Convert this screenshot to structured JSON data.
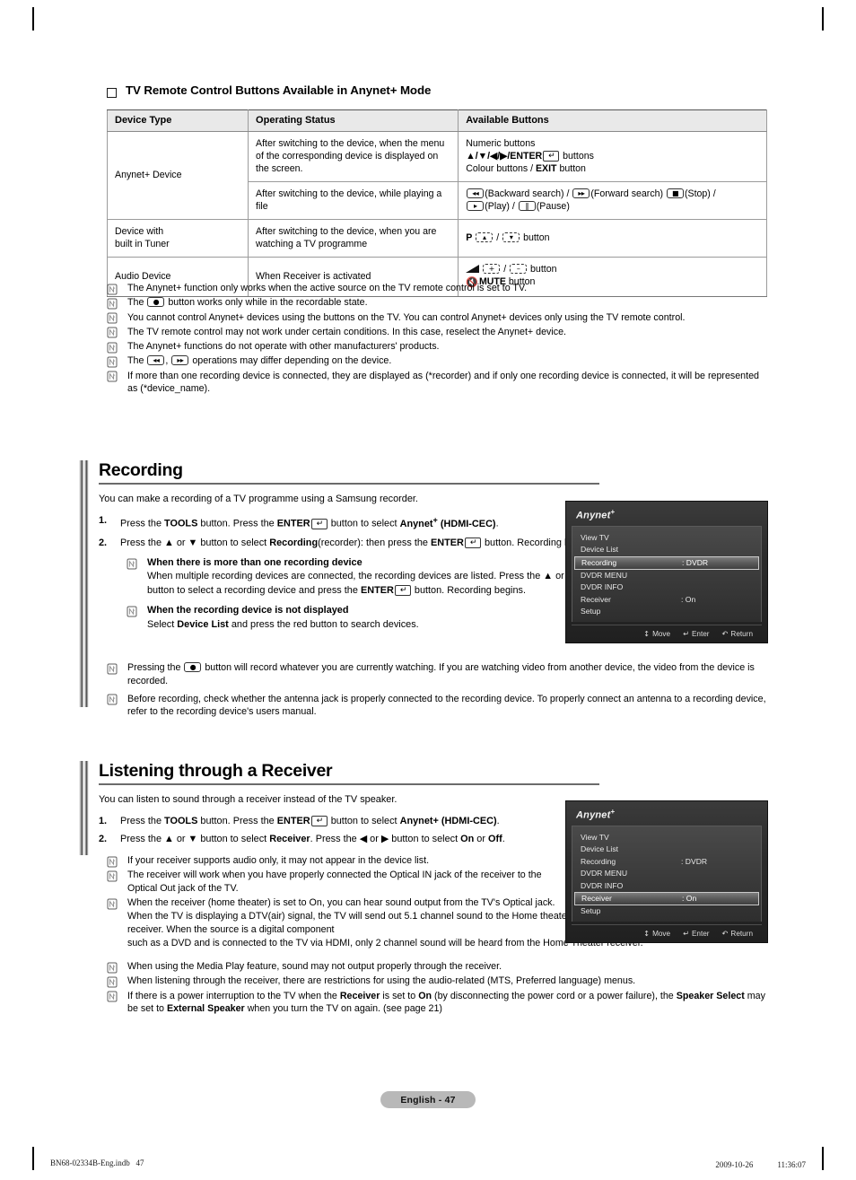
{
  "page": {
    "number_label": "English - 47",
    "footer_left": "BN68-02334B-Eng.indb   47",
    "footer_right": "2009-10-26   　　 11:36:07"
  },
  "remote_section": {
    "heading": "TV Remote Control Buttons Available in Anynet+ Mode",
    "table": {
      "headers": [
        "Device Type",
        "Operating Status",
        "Available Buttons"
      ],
      "rows": [
        {
          "device": "Anynet+ Device",
          "status": "After switching to the device, when the menu of the corresponding device is displayed on the screen.",
          "buttons_lines": [
            "Numeric buttons",
            "▲/▼/◀/▶/ENTER buttons",
            "Colour buttons / EXIT button"
          ]
        },
        {
          "device": "",
          "status": "After switching to the device, while playing a file",
          "buttons_lines": [
            "(Backward search) / (Forward search) (Stop) /",
            "(Play) / (Pause)"
          ]
        },
        {
          "device": "Device with built in Tuner",
          "device_line1": "Device with",
          "device_line2": "built in Tuner",
          "status": "After switching to the device, when you are watching a TV programme",
          "buttons_lines": [
            "P  /  button"
          ]
        },
        {
          "device": "Audio Device",
          "status": "When Receiver is activated",
          "buttons_lines": [
            " / button",
            "MUTE button"
          ]
        }
      ]
    },
    "notes": [
      "The Anynet+ function only works when the active source on the TV remote control is set to TV.",
      "The  button works only while in the recordable state.",
      "You cannot control Anynet+ devices using the buttons on the TV. You can control Anynet+ devices only using the TV remote control.",
      "The TV remote control may not work under certain conditions. In this case, reselect the Anynet+ device.",
      "The Anynet+ functions do not operate with other manufacturers' products.",
      "The  ,  operations may differ depending on the device.",
      "If more than one recording device is connected, they are displayed as (*recorder) and if only one recording device is connected, it will be represented as (*device_name)."
    ]
  },
  "recording": {
    "heading": "Recording",
    "lead": "You can make a recording of a TV programme using a Samsung recorder.",
    "steps": [
      {
        "n": "1.",
        "text": "Press the TOOLS button. Press the ENTER button to select Anynet+ (HDMI-CEC)."
      },
      {
        "n": "2.",
        "text": "Press the ▲ or ▼ button to select Recording(recorder): then press the ENTER button. Recording begins."
      }
    ],
    "subnotes": [
      {
        "title": "When there is more than one recording device",
        "body": "When multiple recording devices are connected, the recording devices are listed. Press the ▲ or ▼ button to select a recording device and press the ENTER button. Recording begins."
      },
      {
        "title": "When the recording device is not displayed",
        "body": "Select Device List and press the red button to search devices."
      }
    ],
    "notes": [
      "Pressing the  button will record whatever you are currently watching. If you are watching video from another device, the video from the device is recorded.",
      "Before recording, check whether the antenna jack is properly connected to the recording device. To properly connect an antenna to a recording device, refer to the recording device's users manual."
    ]
  },
  "receiver": {
    "heading": "Listening through a Receiver",
    "lead": "You can listen to sound through a receiver instead of the TV speaker.",
    "steps": [
      {
        "n": "1.",
        "text": "Press the TOOLS button. Press the ENTER button to select Anynet+ (HDMI-CEC)."
      },
      {
        "n": "2.",
        "text": "Press the ▲ or ▼ button to select Receiver. Press the ◀ or ▶ button to select On or Off."
      }
    ],
    "notes": [
      "If your receiver supports audio only, it may not appear in the device list.",
      "The receiver will work when you have properly connected the Optical IN jack of the receiver to the Optical Out jack of the TV.",
      "When the receiver (home theater) is set to On, you can hear sound output from the TV's Optical jack. When the TV is displaying a DTV(air) signal, the TV will send out 5.1 channel sound to the Home theater receiver. When the source is a digital component such as a DVD and is connected to the TV via HDMI, only 2 channel sound will be heard from the Home Theater receiver.",
      "When using the Media Play feature, sound may not output properly through the receiver.",
      "When listening through the receiver, there are restrictions for using the audio-related (MTS, Preferred language) menus.",
      "If there is a power interruption to the TV when the Receiver is set to On (by disconnecting the power cord or a power failure), the Speaker Select may be set to External Speaker when you turn the TV on again. (see page 21)"
    ]
  },
  "osd": {
    "brand": "Anynet",
    "brand_sup": "+",
    "items": [
      {
        "label": "View TV",
        "value": ""
      },
      {
        "label": "Device List",
        "value": ""
      },
      {
        "label": "Recording",
        "value": ": DVDR"
      },
      {
        "label": "DVDR MENU",
        "value": ""
      },
      {
        "label": "DVDR INFO",
        "value": ""
      },
      {
        "label": "Receiver",
        "value": ": On"
      },
      {
        "label": "Setup",
        "value": ""
      }
    ],
    "selected_recording": "Recording",
    "selected_receiver": "Receiver",
    "footer": [
      {
        "icon": "↕",
        "label": "Move"
      },
      {
        "icon": "↵",
        "label": "Enter"
      },
      {
        "icon": "↶",
        "label": "Return"
      }
    ]
  }
}
